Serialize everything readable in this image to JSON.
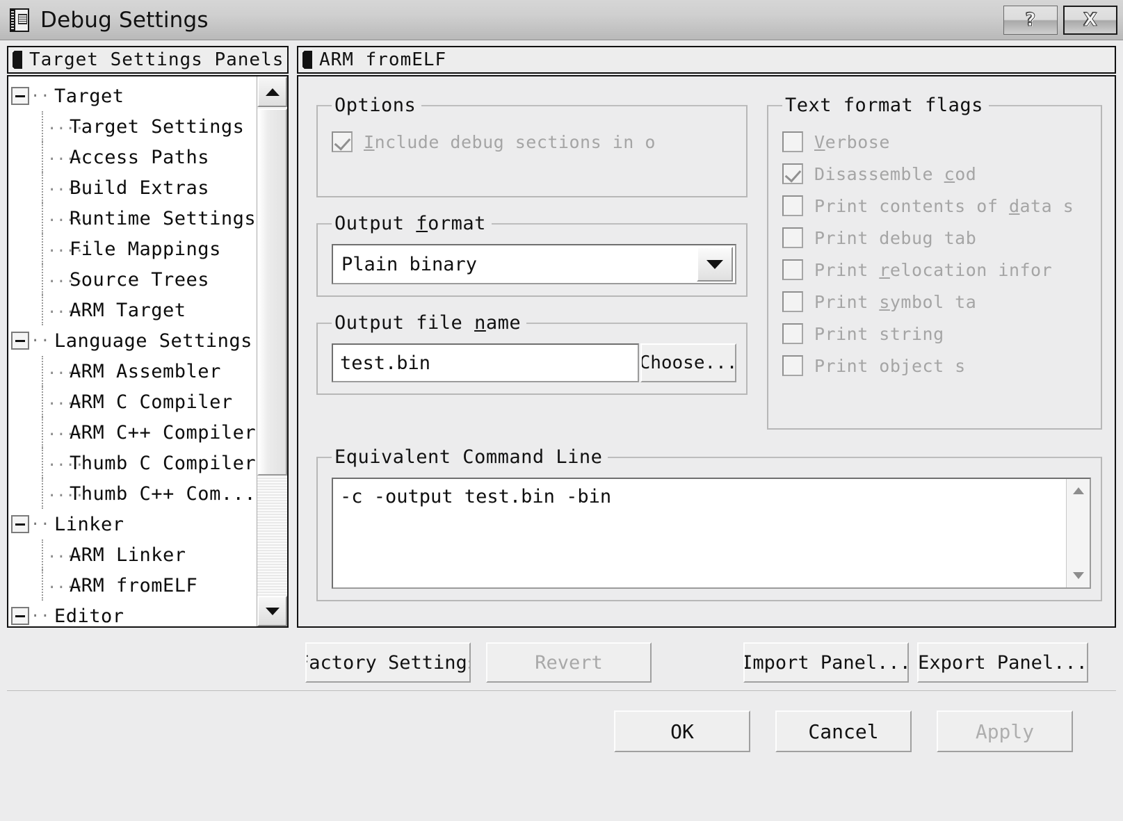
{
  "window": {
    "title": "Debug Settings",
    "icon": "settings-document-icon",
    "help_button": "?",
    "close_button": "X"
  },
  "left_panel": {
    "header": "Target Settings Panels",
    "header_icon": "panel-icon",
    "tree": [
      {
        "label": "Target",
        "level": 0,
        "expanded": true
      },
      {
        "label": "Target Settings",
        "level": 1
      },
      {
        "label": "Access Paths",
        "level": 1
      },
      {
        "label": "Build Extras",
        "level": 1
      },
      {
        "label": "Runtime Settings",
        "level": 1
      },
      {
        "label": "File Mappings",
        "level": 1
      },
      {
        "label": "Source Trees",
        "level": 1
      },
      {
        "label": "ARM Target",
        "level": 1
      },
      {
        "label": "Language Settings",
        "level": 0,
        "expanded": true
      },
      {
        "label": "ARM Assembler",
        "level": 1
      },
      {
        "label": "ARM C Compiler",
        "level": 1
      },
      {
        "label": "ARM C++ Compiler",
        "level": 1
      },
      {
        "label": "Thumb C Compiler",
        "level": 1
      },
      {
        "label": "Thumb C++ Com...",
        "level": 1
      },
      {
        "label": "Linker",
        "level": 0,
        "expanded": true
      },
      {
        "label": "ARM Linker",
        "level": 1
      },
      {
        "label": "ARM fromELF",
        "level": 1
      },
      {
        "label": "Editor",
        "level": 0,
        "expanded": true
      }
    ],
    "scrollbar": {
      "up": "scroll-up-arrow",
      "down": "scroll-down-arrow"
    }
  },
  "right_panel": {
    "header": "ARM fromELF",
    "header_icon": "panel-icon",
    "options": {
      "legend": "Options",
      "checkbox_label": "Include debug sections in o",
      "checkbox_accel": "I",
      "checked": true,
      "disabled": true
    },
    "output_format": {
      "legend_before": "Output ",
      "legend_accel": "f",
      "legend_after": "ormat",
      "value": "Plain binary",
      "dropdown_icon": "chevron-down-icon"
    },
    "output_file_name": {
      "legend_before": "Output file ",
      "legend_accel": "n",
      "legend_after": "ame",
      "value": "test.bin",
      "choose_label": "Choose..."
    },
    "text_format_flags": {
      "legend": "Text format flags",
      "items": [
        {
          "label_before": "",
          "accel": "V",
          "label_after": "erbose",
          "checked": false
        },
        {
          "label_before": "Disassemble ",
          "accel": "c",
          "label_after": "od",
          "checked": true
        },
        {
          "label_before": "Print contents of ",
          "accel": "d",
          "label_after": "ata s",
          "checked": false
        },
        {
          "label_before": "Print debug tab",
          "accel": "",
          "label_after": "",
          "checked": false
        },
        {
          "label_before": "Print ",
          "accel": "r",
          "label_after": "elocation infor",
          "checked": false
        },
        {
          "label_before": "Print ",
          "accel": "s",
          "label_after": "ymbol ta",
          "checked": false
        },
        {
          "label_before": "Print string ",
          "accel": "",
          "label_after": "",
          "checked": false
        },
        {
          "label_before": "Print object s",
          "accel": "",
          "label_after": "",
          "checked": false
        }
      ],
      "disabled": true
    },
    "command_line": {
      "legend": "Equivalent Command Line",
      "value": "-c -output test.bin -bin"
    }
  },
  "panel_buttons": {
    "factory_settings": "Factory Settings",
    "revert": "Revert",
    "revert_disabled": true,
    "import_panel": "Import Panel...",
    "export_panel": "Export Panel..."
  },
  "footer": {
    "ok": "OK",
    "cancel": "Cancel",
    "apply": "Apply",
    "apply_disabled": true
  },
  "colors": {
    "dialog_face": "#ececed",
    "field_bg": "#ffffff",
    "disabled_text": "#a5a5a5",
    "text": "#111111",
    "border": "#111111"
  }
}
